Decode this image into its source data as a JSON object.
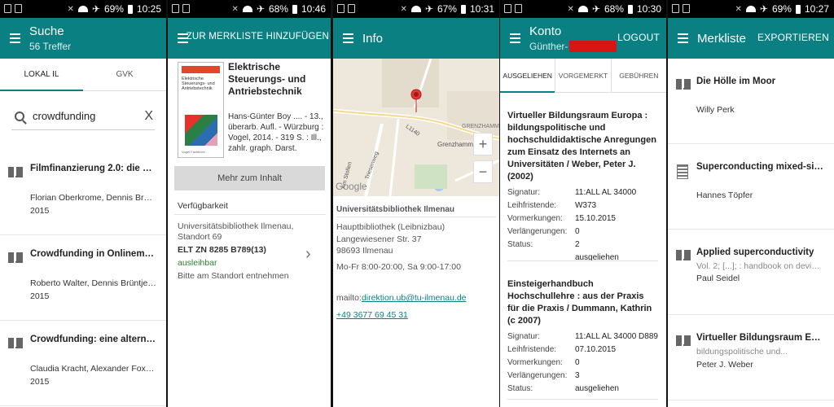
{
  "panels": [
    {
      "status": {
        "battery": "69%",
        "time": "10:25"
      },
      "appbar": {
        "title": "Suche",
        "subtitle": "56 Treffer"
      },
      "tabs": [
        "LOKAL IL",
        "GVK"
      ],
      "search": {
        "value": "crowdfunding"
      },
      "results": [
        {
          "title": "Filmfinanzierung 2.0: die Rolle...",
          "authors": "Florian Oberkrome, Dennis Brüntje,...",
          "year": "2015"
        },
        {
          "title": "Crowdfunding in Onlinemedien ...",
          "authors": "Roberto Walter, Dennis Brüntje,...",
          "year": "2015"
        },
        {
          "title": "Crowdfunding: eine alternative...",
          "authors": "Claudia Kracht, Alexander Fox, Ralf...",
          "year": "2015"
        }
      ]
    },
    {
      "status": {
        "battery": "68%",
        "time": "10:46"
      },
      "appbar": {
        "action": "ZUR MERKLISTE HINZUFÜGEN"
      },
      "cover": {
        "publisher": "Vogel Fachbuch",
        "title_line1": "Elektrische",
        "title_line2": "Steuerungs- und",
        "title_line3": "Antriebstechnik"
      },
      "book": {
        "title": "Elektrische Steuerungs- und Antriebstechnik",
        "meta": "Hans-Günter Boy .... - 13., überarb. Aufl. - Würzburg : Vogel, 2014. - 319 S. : Ill., zahlr. graph. Darst."
      },
      "more_button": "Mehr zum Inhalt",
      "availability": {
        "heading": "Verfügbarkeit",
        "library": "Universitätsbibliothek Ilmenau, Standort 69",
        "signature": "ELT ZN 8285 B789(13)",
        "status": "ausleihbar",
        "note": "Bitte am Standort entnehmen"
      }
    },
    {
      "status": {
        "battery": "67%",
        "time": "10:31"
      },
      "appbar": {
        "title": "Info"
      },
      "map": {
        "labels": [
          "GRENZHAMM",
          "Grenzhammer",
          "L1140",
          "Am Stollen",
          "Triesenweg"
        ],
        "google": "Google"
      },
      "info": {
        "name": "Universitätsbibliothek Ilmenau",
        "building": "Hauptbibliothek (Leibnizbau)",
        "street": "Langewiesener Str. 37",
        "city": "98693 Ilmenau",
        "hours": "Mo-Fr 8:00-20:00, Sa 9:00-17:00",
        "mail_prefix": "mailto:",
        "mail": "direktion.ub@tu-ilmenau.de",
        "phone": "+49 3677 69 45 31"
      }
    },
    {
      "status": {
        "battery": "68%",
        "time": "10:30"
      },
      "appbar": {
        "title": "Konto",
        "subtitle": "Günther-",
        "action": "LOGOUT"
      },
      "tabs": [
        "AUSGELIEHEN",
        "VORGEMERKT",
        "GEBÜHREN"
      ],
      "field_labels": [
        "Signatur:",
        "Leihfristende:",
        "Vormerkungen:",
        "Verlängerungen:",
        "Status:"
      ],
      "loans": [
        {
          "title": "Virtueller Bildungsraum Europa : bildungspolitische und hochschuldidaktische Anregungen zum Einsatz des Internets an Universitäten / Weber, Peter J. (2002)",
          "values": [
            "11:ALL AL 34000 W373",
            "15.10.2015",
            "0",
            "2",
            "ausgeliehen"
          ]
        },
        {
          "title": "Einsteigerhandbuch Hochschullehre : aus der Praxis für die Praxis / Dummann, Kathrin (c 2007)",
          "values": [
            "11:ALL AL 34000 D889",
            "07.10.2015",
            "0",
            "3",
            "ausgeliehen"
          ]
        }
      ]
    },
    {
      "status": {
        "battery": "69%",
        "time": "10:27"
      },
      "appbar": {
        "title": "Merkliste",
        "action": "EXPORTIEREN"
      },
      "items": [
        {
          "title": "Die Hölle im Moor",
          "sub": "",
          "author": "Willy Perk"
        },
        {
          "title": "Superconducting mixed-signal...",
          "sub": "",
          "author": "Hannes Töpfer"
        },
        {
          "title": "Applied superconductivity",
          "sub": "Vol. 2; [...]; : handbook on devices an...",
          "author": "Paul Seidel"
        },
        {
          "title": "Virtueller Bildungsraum Europa",
          "sub": "bildungspolitische und...",
          "author": "Peter J. Weber"
        }
      ]
    }
  ]
}
